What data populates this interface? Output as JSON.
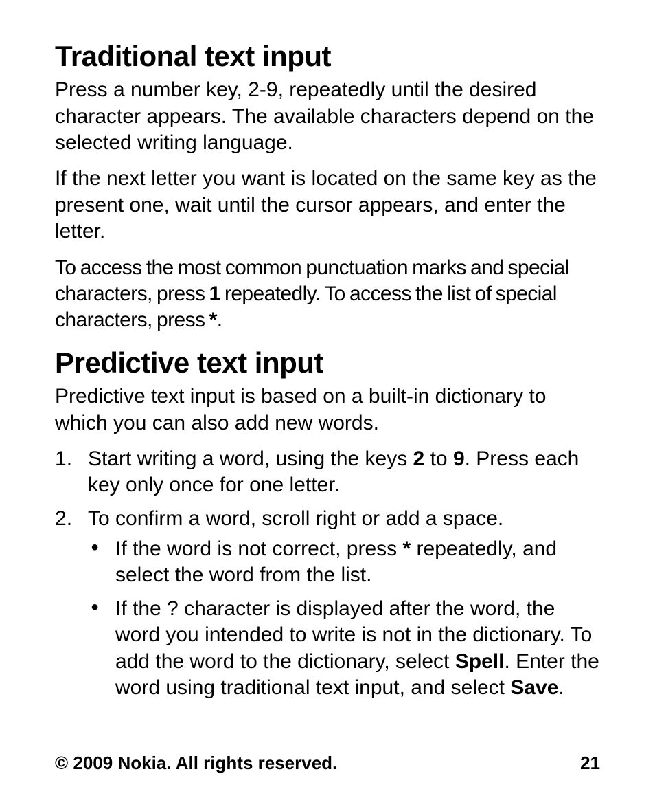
{
  "section1": {
    "heading": "Traditional text input",
    "p1": "Press a number key, 2-9, repeatedly until the desired character appears. The available characters depend on the selected writing language.",
    "p2": "If the next letter you want is located on the same key as the present one, wait until the cursor appears, and enter the letter.",
    "p3_a": "To access the most common punctuation marks and special characters, press ",
    "p3_b1": "1",
    "p3_c": " repeatedly. To access the list of special characters, press ",
    "p3_b2": "*",
    "p3_d": "."
  },
  "section2": {
    "heading": "Predictive text input",
    "p1": "Predictive text input is based on a built-in dictionary to which you can also add new words.",
    "li1_a": "Start writing a word, using the keys ",
    "li1_b1": "2",
    "li1_b": " to ",
    "li1_b2": "9",
    "li1_c": ". Press each key only once for one letter.",
    "li2": "To confirm a word, scroll right or add a space.",
    "li2_sub1_a": "If the word is not correct, press ",
    "li2_sub1_b": "*",
    "li2_sub1_c": " repeatedly, and select the word from the list.",
    "li2_sub2_a": "If the ? character is displayed after the word, the word you intended to write is not in the dictionary. To add the word to the dictionary, select ",
    "li2_sub2_b1": "Spell",
    "li2_sub2_c": ". Enter the word using traditional text input, and select ",
    "li2_sub2_b2": "Save",
    "li2_sub2_d": "."
  },
  "footer": {
    "copyright": "© 2009 Nokia. All rights reserved.",
    "page": "21"
  }
}
